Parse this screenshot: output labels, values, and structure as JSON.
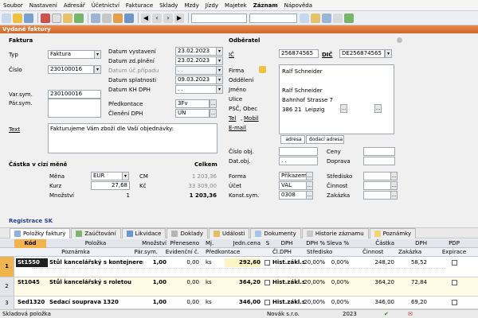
{
  "menu": [
    "Soubor",
    "Nastavení",
    "Adresář",
    "Účetnictví",
    "Fakturace",
    "Sklady",
    "Mzdy",
    "Jízdy",
    "Majetek",
    "Záznam",
    "Nápověda"
  ],
  "title": "Vydané faktury",
  "faktura": {
    "section": "Faktura",
    "typ_label": "Typ",
    "typ_value": "Faktura",
    "cislo_label": "Číslo",
    "cislo_value": "230100016",
    "varsym_label": "Var.sym.",
    "varsym_value": "230100016",
    "parsym_label": "Pár.sym.",
    "datum_vystaveni_label": "Datum vystavení",
    "datum_vystaveni": "23.02.2023",
    "datum_zdpl_label": "Datum zd.plnění",
    "datum_zdpl": "23.02.2023",
    "datum_ucpripadu_label": "Datum úč.případu",
    "datum_ucpripadu": ". .",
    "datum_splatnosti_label": "Datum splatnosti",
    "datum_splatnosti": "09.03.2023",
    "datum_khdph_label": "Datum KH DPH",
    "datum_khdph": ". .",
    "predkontace_label": "Předkontace",
    "predkontace": "3Fv",
    "cleneni_label": "Členění DPH",
    "cleneni": "UN",
    "text_label": "Text",
    "text_value": "Fakturujeme Vám zboží dle Vaší objednávky:"
  },
  "castka": {
    "header": "Částka v cizí měně",
    "celkem_label": "Celkem",
    "mena_label": "Měna",
    "mena_value": "EUR",
    "cm_label": "CM",
    "cm_value": "1 203,36",
    "kurz_label": "Kurz",
    "kurz_value": "27,68",
    "kc_label": "Kč",
    "kc_value": "33 309,00",
    "mnozstvi_label": "Množství",
    "mnozstvi_value": "1",
    "celkem_value": "1 203,36"
  },
  "odberatel": {
    "section": "Odběratel",
    "ic_label": "IČ",
    "ic_value": "256874565",
    "dic_label": "DIČ",
    "dic_value": "DE256874565",
    "firma_label": "Firma",
    "firma_value": "Ralf Schneider",
    "oddeleni_label": "Oddělení",
    "jmeno_label": "Jméno",
    "jmeno_value": "Ralf Schneider",
    "ulice_label": "Ulice",
    "ulice_value": "Bahnhof Strasse 7",
    "psc_label": "PSČ, Obec",
    "psc_value": "386 21",
    "obec_value": "Leipzig",
    "tel_label": "Tel",
    "mobil_label": "Mobil",
    "email_label": "E-mail",
    "adresa_btn": "adresa",
    "dodaci_btn": "dodací adresa",
    "cislo_obj_label": "Číslo obj.",
    "dat_obj_label": "Dat.obj.",
    "dat_obj_value": ". .",
    "ceny_label": "Ceny",
    "doprava_label": "Doprava",
    "forma_label": "Forma",
    "forma_value": "Příkazem",
    "ucet_label": "Účet",
    "ucet_value": "VAL",
    "konstsym_label": "Konst.sym.",
    "konstsym_value": "0308",
    "stredisko_label": "Středisko",
    "cinnost_label": "Činnost",
    "zakazka_label": "Zakázka"
  },
  "registrace": "Registrace SK",
  "tabs": [
    "Položky faktury",
    "Zaúčtování",
    "Likvidace",
    "Doklady",
    "Události",
    "Dokumenty",
    "Historie záznamu",
    "Poznámky"
  ],
  "grid": {
    "head1": [
      "Kód",
      "Položka",
      "Množství",
      "Přeneseno",
      "Mj.",
      "Jedn.cena",
      "S",
      "DPH",
      "DPH %",
      "Sleva %",
      "Částka",
      "DPH",
      "PDP"
    ],
    "head2": [
      "Poznámka",
      "Pár.sym.",
      "Evidenční č.",
      "Předkontace",
      "Čl.DPH",
      "Středisko",
      "Činnost",
      "Zakázka",
      "Expirace"
    ],
    "rows": [
      {
        "num": "1",
        "kod": "St1550",
        "polozka": "Stůl kancelářský s kontejnerem",
        "mnozstvi": "1,00",
        "preneseno": "0,00",
        "mj": "ks",
        "cena": "292,60",
        "dph": "Hist.zákl.s.",
        "dphp": "20,00%",
        "sleva": "0,00%",
        "castka": "248,20",
        "dphv": "58,52"
      },
      {
        "num": "2",
        "kod": "St1045",
        "polozka": "Stůl kancelářský s roletou",
        "mnozstvi": "1,00",
        "preneseno": "0,00",
        "mj": "ks",
        "cena": "364,20",
        "dph": "Hist.zákl.s.",
        "dphp": "20,00%",
        "sleva": "0,00%",
        "castka": "364,20",
        "dphv": "72,84"
      },
      {
        "num": "3",
        "kod": "Sed1320",
        "polozka": "Sedací souprava 1320",
        "mnozstvi": "1,00",
        "preneseno": "0,00",
        "mj": "ks",
        "cena": "346,00",
        "dph": "Hist.zákl.s.",
        "dphp": "20,00%",
        "sleva": "0,00%",
        "castka": "346,00",
        "dphv": "69,20"
      }
    ]
  },
  "status": {
    "left": "Skladová položka",
    "company": "Novák s.r.o.",
    "year": "2023"
  }
}
